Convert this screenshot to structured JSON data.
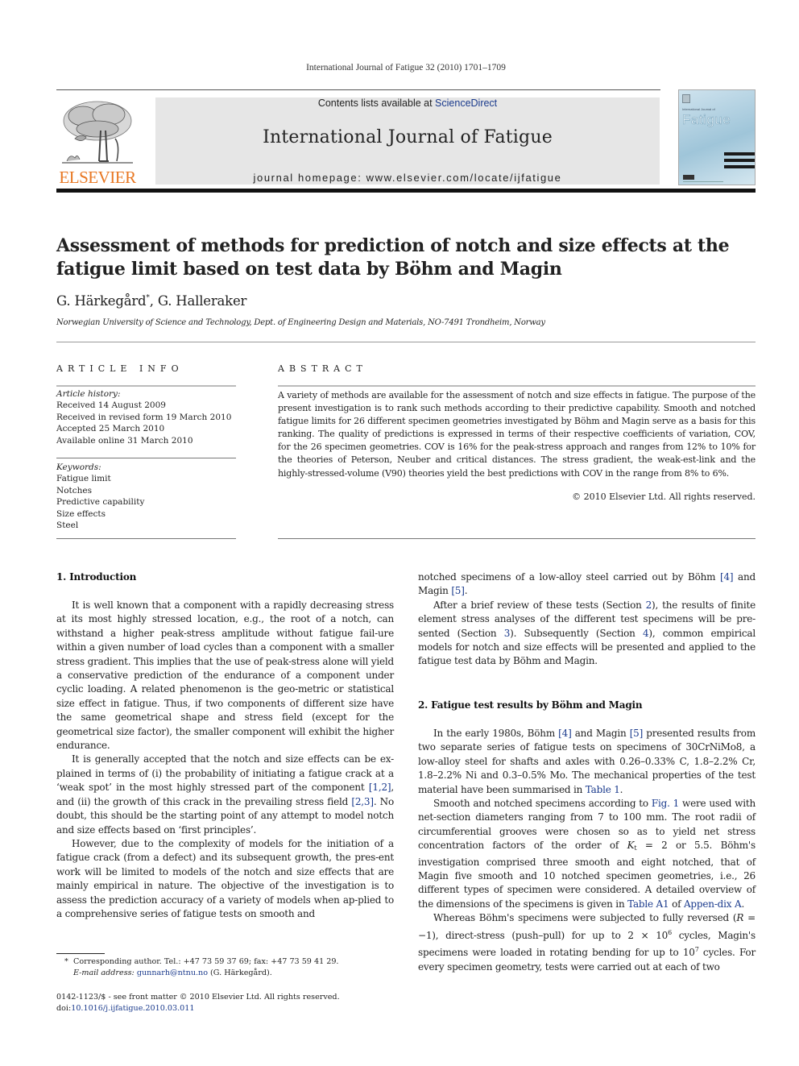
{
  "header": {
    "journal_reference": "International Journal of Fatigue 32 (2010) 1701–1709",
    "contents_prefix": "Contents lists available at ",
    "contents_link": "ScienceDirect",
    "journal_title": "International Journal of Fatigue",
    "homepage": "journal homepage: www.elsevier.com/locate/ijfatigue",
    "publisher_wordmark": "ELSEVIER",
    "cover_subtitle": "International Journal of",
    "cover_title": "Fatigue",
    "brand_color": "#e87722",
    "link_color": "#1a3a8c"
  },
  "article": {
    "title": "Assessment of methods for prediction of notch and size effects at the fatigue limit based on test data by Böhm and Magin",
    "authors": [
      {
        "name": "G. Härkegård",
        "mark": "*"
      },
      {
        "name": "G. Halleraker",
        "mark": ""
      }
    ],
    "author_separator": ", ",
    "affiliation": "Norwegian University of Science and Technology, Dept. of Engineering Design and Materials, NO-7491 Trondheim, Norway"
  },
  "article_info": {
    "heading": "ARTICLE INFO",
    "history_label": "Article history:",
    "history": [
      "Received 14 August 2009",
      "Received in revised form 19 March 2010",
      "Accepted 25 March 2010",
      "Available online 31 March 2010"
    ],
    "keywords_label": "Keywords:",
    "keywords": [
      "Fatigue limit",
      "Notches",
      "Predictive capability",
      "Size effects",
      "Steel"
    ]
  },
  "abstract": {
    "heading": "ABSTRACT",
    "text": "A variety of methods are available for the assessment of notch and size effects in fatigue. The purpose of the present investigation is to rank such methods according to their predictive capability. Smooth and notched fatigue limits for 26 different specimen geometries investigated by Böhm and Magin serve as a basis for this ranking. The quality of predictions is expressed in terms of their respective coefficients of variation, COV, for the 26 specimen geometries. COV is 16% for the peak-stress approach and ranges from 12% to 10% for the theories of Peterson, Neuber and critical distances. The stress gradient, the weak-est-link and the highly-stressed-volume (V90) theories yield the best predictions with COV in the range from 8% to 6%.",
    "copyright": "© 2010 Elsevier Ltd. All rights reserved."
  },
  "body": {
    "section1_title": "1. Introduction",
    "s1_p1": "It is well known that a component with a rapidly decreasing stress at its most highly stressed location, e.g., the root of a notch, can withstand a higher peak-stress amplitude without fatigue fail-ure within a given number of load cycles than a component with a smaller stress gradient. This implies that the use of peak-stress alone will yield a conservative prediction of the endurance of a component under cyclic loading. A related phenomenon is the geo-metric or statistical size effect in fatigue. Thus, if two components of different size have the same geometrical shape and stress field (except for the geometrical size factor), the smaller component will exhibit the higher endurance.",
    "s1_p2_a": "It is generally accepted that the notch and size effects can be ex-plained in terms of (i) the probability of initiating a fatigue crack at a ‘weak spot’ in the most highly stressed part of the component ",
    "s1_p2_ref1": "[1,2]",
    "s1_p2_b": ", and (ii) the growth of this crack in the prevailing stress field ",
    "s1_p2_ref2": "[2,3]",
    "s1_p2_c": ". No doubt, this should be the starting point of any attempt to model notch and size effects based on ‘first principles’.",
    "s1_p3": "However, due to the complexity of models for the initiation of a fatigue crack (from a defect) and its subsequent growth, the pres-ent work will be limited to models of the notch and size effects that are mainly empirical in nature. The objective of the investigation is to assess the prediction accuracy of a variety of models when ap-plied to a comprehensive series of fatigue tests on smooth and",
    "s1_p3_cont_a": "notched specimens of a low-alloy steel carried out by Böhm ",
    "s1_p3_ref4": "[4]",
    "s1_p3_cont_b": " and Magin ",
    "s1_p3_ref5": "[5]",
    "s1_p3_cont_c": ".",
    "s1_p4_a": "After a brief review of these tests (Section ",
    "s1_p4_sec2": "2",
    "s1_p4_b": "), the results of finite element stress analyses of the different test specimens will be pre-sented (Section ",
    "s1_p4_sec3": "3",
    "s1_p4_c": "). Subsequently (Section ",
    "s1_p4_sec4": "4",
    "s1_p4_d": "), common empirical models for notch and size effects will be presented and applied to the fatigue test data by Böhm and Magin.",
    "section2_title": "2. Fatigue test results by Böhm and Magin",
    "s2_p1_a": "In the early 1980s, Böhm ",
    "s2_p1_ref4": "[4]",
    "s2_p1_b": " and Magin ",
    "s2_p1_ref5": "[5]",
    "s2_p1_c": " presented results from two separate series of fatigue tests on specimens of 30CrNiMo8, a low-alloy steel for shafts and axles with 0.26–0.33% C, 1.8–2.2% Cr, 1.8–2.2% Ni and 0.3–0.5% Mo. The mechanical properties of the test material have been summarised in ",
    "s2_p1_table": "Table 1",
    "s2_p1_d": ".",
    "s2_p2_a": "Smooth and notched specimens according to ",
    "s2_p2_fig": "Fig. 1",
    "s2_p2_b": " were used with net-section diameters ranging from 7 to 100 mm. The root radii of circumferential grooves were chosen so as to yield net stress concentration factors of the order of ",
    "s2_p2_kt": "K",
    "s2_p2_kt_sub": "t",
    "s2_p2_c": " = 2 or 5.5. Böhm's investigation comprised three smooth and eight notched, that of Magin five smooth and 10 notched specimen geometries, i.e., 26 different types of specimen were considered. A detailed overview of the dimensions of the specimens is given in ",
    "s2_p2_tableA1": "Table A1",
    "s2_p2_d": " of ",
    "s2_p2_appendix": "Appen-dix A",
    "s2_p2_e": ".",
    "s2_p3_a": "Whereas Böhm's specimens were subjected to fully reversed (",
    "s2_p3_R": "R",
    "s2_p3_b": " = −1), direct-stress (push–pull) for up to 2 × 10",
    "s2_p3_exp1": "6",
    "s2_p3_c": " cycles, Magin's specimens were loaded in rotating bending for up to 10",
    "s2_p3_exp2": "7",
    "s2_p3_d": " cycles. For every specimen geometry, tests were carried out at each of two"
  },
  "footnote": {
    "star": "*",
    "text": "Corresponding author. Tel.: +47 73 59 37 69; fax: +47 73 59 41 29.",
    "email_label": "E-mail address:",
    "email": "gunnarh@ntnu.no",
    "email_suffix": " (G. Härkegård)."
  },
  "issn": {
    "line": "0142-1123/$ - see front matter © 2010 Elsevier Ltd. All rights reserved.",
    "doi_label": "doi:",
    "doi": "10.1016/j.ijfatigue.2010.03.011"
  }
}
